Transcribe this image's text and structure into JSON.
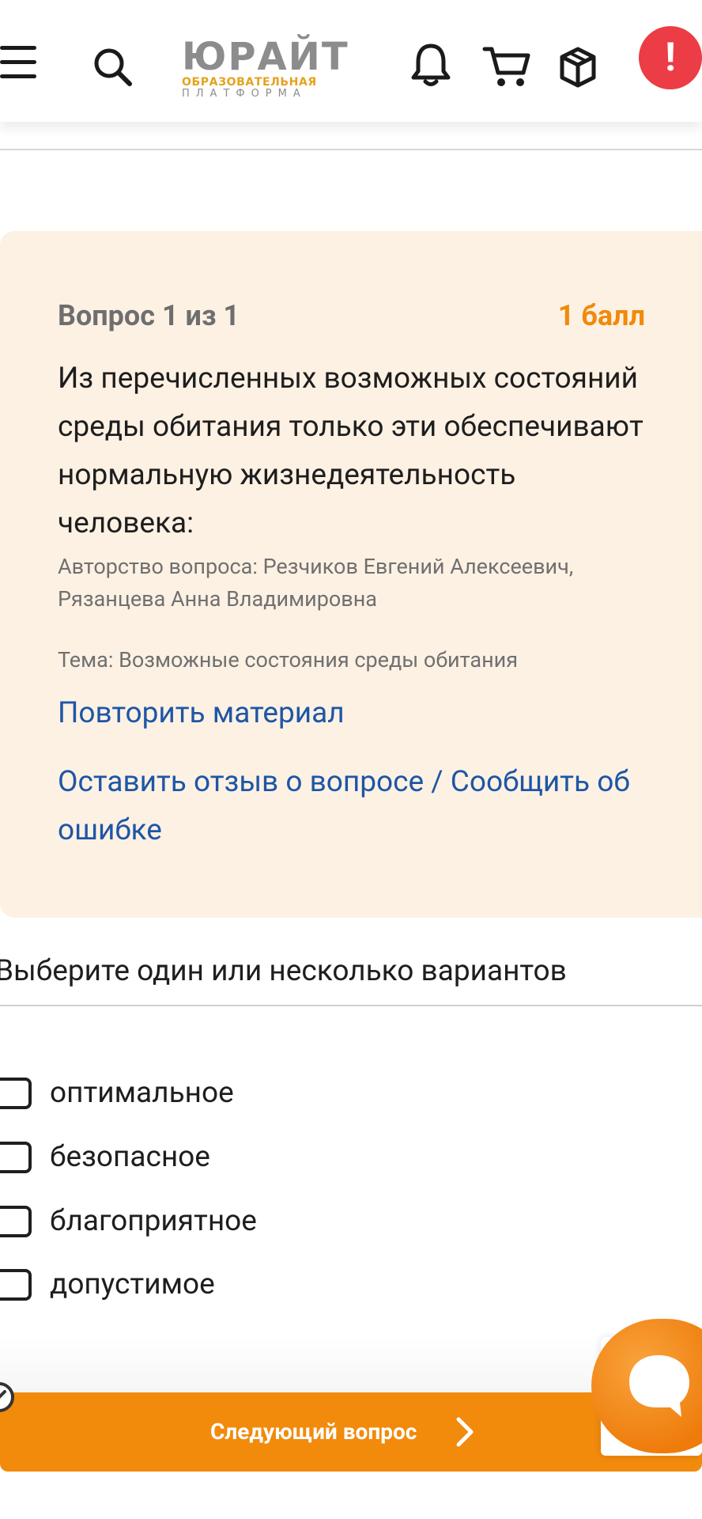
{
  "header": {
    "logo": {
      "brand": "ЮРАЙТ",
      "line1": "ОБРАЗОВАТЕЛЬНАЯ",
      "line2": "ПЛАТФОРМА"
    },
    "alert_symbol": "!",
    "colors": {
      "logo_gray": "#8c8c8c",
      "logo_gold": "#e4a21c",
      "alert": "#ec3c45"
    }
  },
  "question": {
    "number_label": "Вопрос 1 из 1",
    "score_label": "1 балл",
    "text": "Из перечисленных возможных состояний среды обитания только эти обеспечивают нормальную жизнедеятельность человека:",
    "authors": "Авторство вопроса: Резчиков Евгений Алексеевич, Рязанцева Анна Владимировна",
    "topic": "Тема: Возможные состояния среды обитания",
    "repeat_link": "Повторить материал",
    "feedback_link": "Оставить отзыв о вопросе / Сообщить об ошибке",
    "colors": {
      "card_bg": "#fdf1e4",
      "score": "#f08a0a",
      "link": "#1d56a5"
    }
  },
  "answers": {
    "instruction": "Выберите один или несколько вариантов",
    "options": [
      {
        "label": "оптимальное",
        "checked": false
      },
      {
        "label": "безопасное",
        "checked": false
      },
      {
        "label": "благоприятное",
        "checked": false
      },
      {
        "label": "допустимое",
        "checked": false
      }
    ]
  },
  "footer": {
    "next_label": "Следующий вопрос",
    "colors": {
      "button": "#f28a0c"
    }
  },
  "icons": [
    "menu-icon",
    "search-icon",
    "bell-icon",
    "cart-icon",
    "box-icon",
    "alert-icon",
    "chevron-right-icon",
    "chat-icon"
  ]
}
